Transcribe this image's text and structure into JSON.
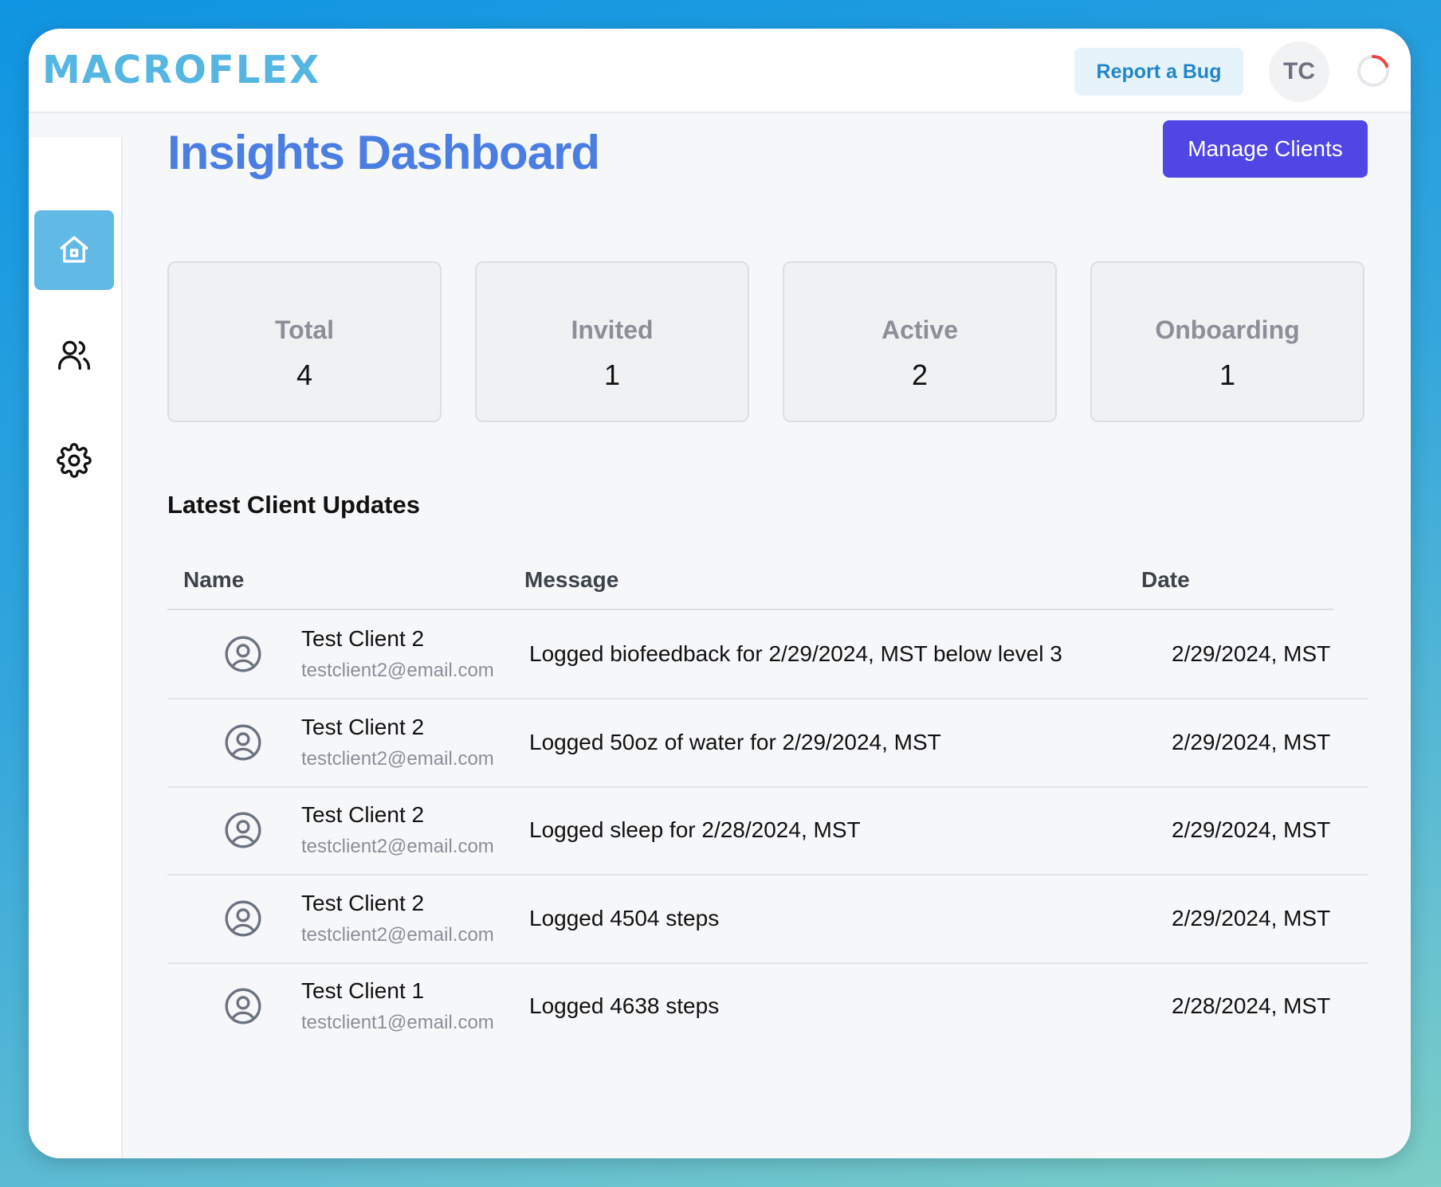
{
  "app": {
    "logo_text": "MACROFLEX",
    "report_bug_label": "Report a Bug",
    "user_initials": "TC",
    "accent_color": "#56b6e2",
    "primary_button_color": "#4f46e5"
  },
  "sidebar": {
    "items": [
      {
        "icon": "home-icon",
        "active": true
      },
      {
        "icon": "users-icon",
        "active": false
      },
      {
        "icon": "gear-icon",
        "active": false
      }
    ]
  },
  "page": {
    "title": "Insights Dashboard",
    "manage_clients_label": "Manage Clients"
  },
  "stats": [
    {
      "label": "Total",
      "value": "4"
    },
    {
      "label": "Invited",
      "value": "1"
    },
    {
      "label": "Active",
      "value": "2"
    },
    {
      "label": "Onboarding",
      "value": "1"
    }
  ],
  "updates": {
    "title": "Latest Client Updates",
    "columns": [
      "Name",
      "Message",
      "Date"
    ],
    "rows": [
      {
        "name": "Test Client 2",
        "email": "testclient2@email.com",
        "message": "Logged biofeedback for 2/29/2024, MST below level 3",
        "date": "2/29/2024, MST"
      },
      {
        "name": "Test Client 2",
        "email": "testclient2@email.com",
        "message": "Logged 50oz of water for 2/29/2024, MST",
        "date": "2/29/2024, MST"
      },
      {
        "name": "Test Client 2",
        "email": "testclient2@email.com",
        "message": "Logged sleep for 2/28/2024, MST",
        "date": "2/29/2024, MST"
      },
      {
        "name": "Test Client 2",
        "email": "testclient2@email.com",
        "message": "Logged 4504 steps",
        "date": "2/29/2024, MST"
      },
      {
        "name": "Test Client 1",
        "email": "testclient1@email.com",
        "message": "Logged 4638 steps",
        "date": "2/28/2024, MST"
      }
    ]
  }
}
